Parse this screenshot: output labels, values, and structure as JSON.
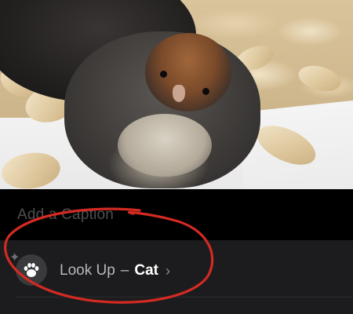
{
  "photo": {
    "subject": "chick",
    "colors": {
      "shavings": "#d9c49c",
      "paper": "#efefef",
      "chick_dark": "#3f3c3a",
      "chick_head": "#a0663a"
    }
  },
  "caption": {
    "placeholder": "Add a Caption"
  },
  "lookup": {
    "prefix": "Look Up",
    "separator": "–",
    "subject": "Cat",
    "chevron": "›",
    "icon": "paw-icon",
    "sparkle": "✦"
  },
  "annotation": {
    "color": "#d32a22"
  }
}
